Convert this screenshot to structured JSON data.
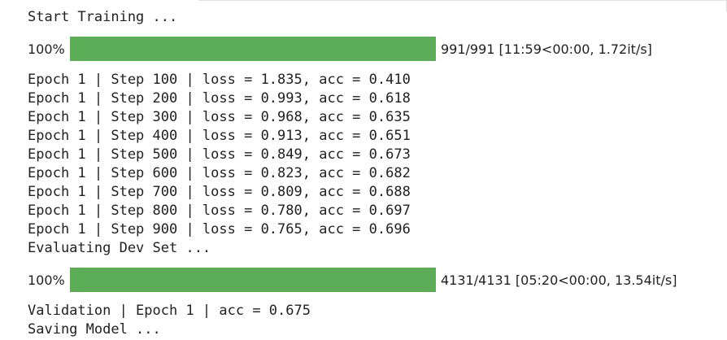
{
  "output": {
    "start_line": "Start Training ...",
    "train_progress": {
      "percent_label": "100%",
      "fraction": 1.0,
      "stats": "991/991 [11:59<00:00, 1.72it/s]"
    },
    "log_lines": [
      "Epoch 1 | Step 100 | loss = 1.835, acc = 0.410",
      "Epoch 1 | Step 200 | loss = 0.993, acc = 0.618",
      "Epoch 1 | Step 300 | loss = 0.968, acc = 0.635",
      "Epoch 1 | Step 400 | loss = 0.913, acc = 0.651",
      "Epoch 1 | Step 500 | loss = 0.849, acc = 0.673",
      "Epoch 1 | Step 600 | loss = 0.823, acc = 0.682",
      "Epoch 1 | Step 700 | loss = 0.809, acc = 0.688",
      "Epoch 1 | Step 800 | loss = 0.780, acc = 0.697",
      "Epoch 1 | Step 900 | loss = 0.765, acc = 0.696",
      "Evaluating Dev Set ..."
    ],
    "dev_progress": {
      "percent_label": "100%",
      "fraction": 1.0,
      "stats": "4131/4131 [05:20<00:00, 13.54it/s]"
    },
    "validation_line": "Validation | Epoch 1 | acc = 0.675",
    "saving_line": "Saving Model ..."
  },
  "colors": {
    "progress_fill": "#5cac58",
    "progress_track": "#e6e6e6",
    "text": "#212121"
  }
}
